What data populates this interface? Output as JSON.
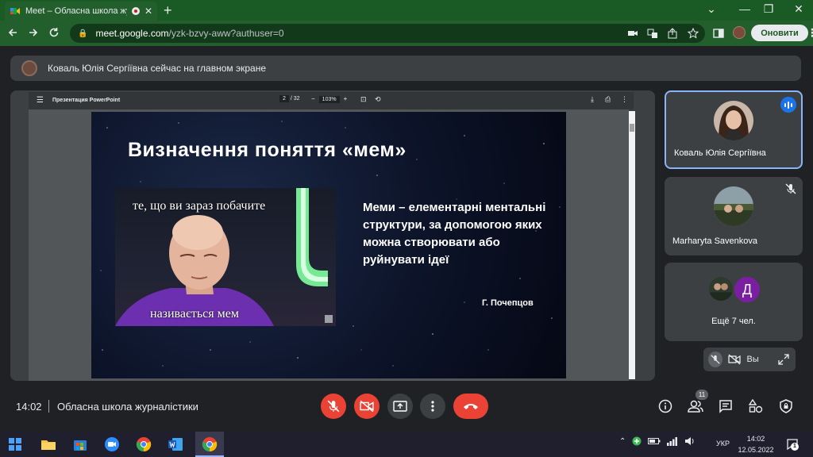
{
  "browser": {
    "tab_title": "Meet – Обласна школа журналістики",
    "tab_close": "✕",
    "new_tab": "+",
    "url_domain": "meet.google.com",
    "url_path": "/yzk-bzvy-aww?authuser=0",
    "incognito_label": "Оновити",
    "window_min": "⌄",
    "window_minimize": "—",
    "window_restore": "❐",
    "window_close": "✕"
  },
  "banner": {
    "text": "Коваль Юлія Сергіївна сейчас на главном экране"
  },
  "pdf_viewer": {
    "title": "Презентация PowerPoint",
    "page_current": "2",
    "page_total": "/ 32",
    "zoom": "103%"
  },
  "slide": {
    "title": "Визначення поняття «мем»",
    "meme_top": "те, що ви зараз побачите",
    "meme_bottom": "називається мем",
    "definition": "Меми – елементарні ментальні структури, за допомогою яких можна створювати або руйнувати ідеї",
    "author": "Г. Почепцов"
  },
  "participants": [
    {
      "name": "Коваль Юлія Сергіївна"
    },
    {
      "name": "Marharyta Savenkova"
    }
  ],
  "more_participants": {
    "initial": "Д",
    "label": "Ещё 7 чел."
  },
  "self_view": {
    "label": "Вы"
  },
  "meet_bar": {
    "time": "14:02",
    "meeting_name": "Обласна школа журналістики",
    "people_count": "11"
  },
  "taskbar": {
    "lang": "УКР",
    "time": "14:02",
    "date": "12.05.2022",
    "notifications": "1"
  },
  "colors": {
    "browser_green": "#235f2d",
    "meet_red": "#ea4335",
    "speaking_blue": "#1a73e8",
    "active_border": "#8ab4f8"
  }
}
